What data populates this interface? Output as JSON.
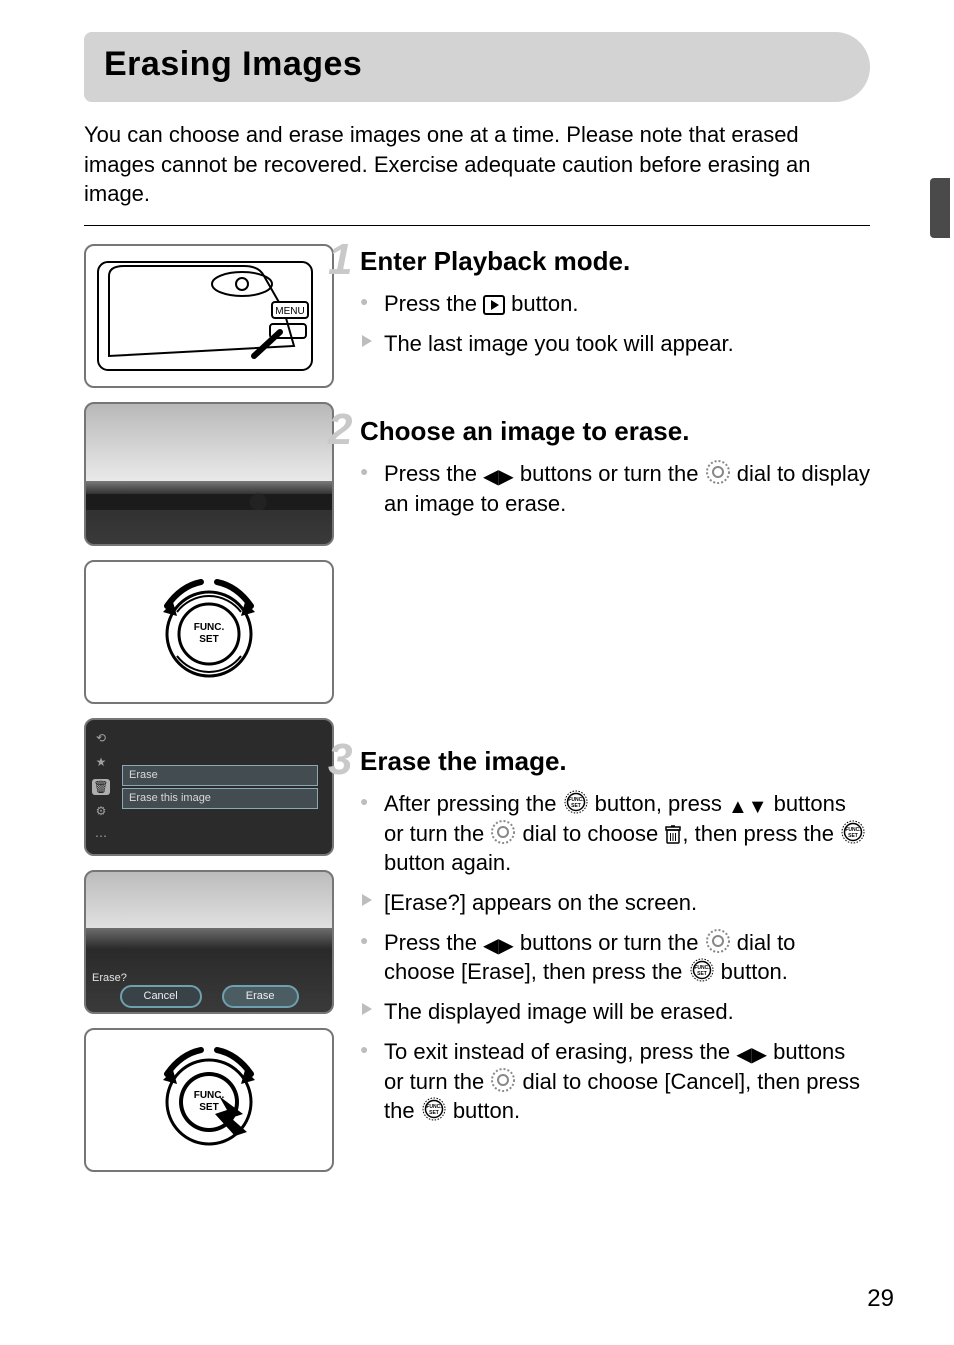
{
  "header": {
    "title": "Erasing Images"
  },
  "intro": "You can choose and erase images one at a time. Please note that erased images cannot be recovered. Exercise adequate caution before erasing an image.",
  "icons": {
    "func_label_top": "FUNC.",
    "func_label_bottom": "SET",
    "menu_label": "MENU"
  },
  "thumbs": {
    "menu": {
      "row1": "Erase",
      "row2": "Erase this image"
    },
    "confirm": {
      "prompt": "Erase?",
      "cancel": "Cancel",
      "erase": "Erase"
    }
  },
  "steps": [
    {
      "num": "1",
      "title": "Enter Playback mode.",
      "items": [
        {
          "type": "dot",
          "key": "s1i1",
          "prefix": "Press the ",
          "mid": " button.",
          "icon": "play"
        },
        {
          "type": "tri",
          "key": "s1i2",
          "text": "The last image you took will appear."
        }
      ]
    },
    {
      "num": "2",
      "title": "Choose an image to erase.",
      "items": [
        {
          "type": "dot",
          "key": "s2i1",
          "a": "Press the ",
          "b": " buttons or turn the ",
          "c": " dial to display an image to erase."
        }
      ]
    },
    {
      "num": "3",
      "title": "Erase the image.",
      "items": [
        {
          "type": "dot",
          "key": "s3i1",
          "a": "After pressing the ",
          "b": " button, press ",
          "c": " buttons or turn the ",
          "d": " dial to choose ",
          "e": ", then press the ",
          "f": " button again."
        },
        {
          "type": "tri",
          "key": "s3i2",
          "text": "[Erase?] appears on the screen."
        },
        {
          "type": "dot",
          "key": "s3i3",
          "a": "Press the ",
          "b": " buttons or turn the ",
          "c": " dial to choose [Erase], then press the ",
          "d": " button."
        },
        {
          "type": "tri",
          "key": "s3i4",
          "text": "The displayed image will be erased."
        },
        {
          "type": "dot",
          "key": "s3i5",
          "a": "To exit instead of erasing, press the ",
          "b": " buttons or turn the ",
          "c": " dial to choose [Cancel], then press the ",
          "d": " button."
        }
      ]
    }
  ],
  "page_number": "29"
}
